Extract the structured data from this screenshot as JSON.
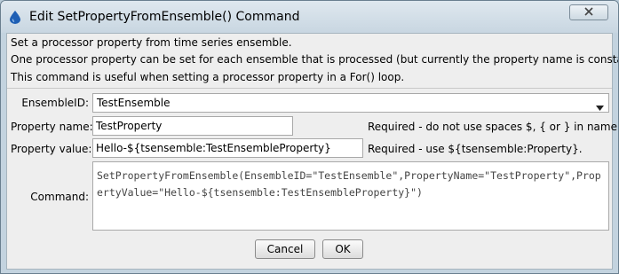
{
  "window": {
    "title": "Edit SetPropertyFromEnsemble() Command"
  },
  "info": {
    "line1": "Set a processor property from time series ensemble.",
    "line2": "One processor property can be set for each ensemble that is processed (but currently the property name is constant).",
    "line3": "This command is useful when setting a processor property in a For() loop."
  },
  "form": {
    "ensemble_label": "EnsembleID:",
    "ensemble_value": "TestEnsemble",
    "property_name_label": "Property name:",
    "property_name_value": "TestProperty",
    "property_name_note": "Required - do not use spaces $, { or } in name.",
    "property_value_label": "Property value:",
    "property_value_value": "Hello-${tsensemble:TestEnsembleProperty}",
    "property_value_note": "Required - use ${tsensemble:Property}.",
    "command_label": "Command:",
    "command_value": "SetPropertyFromEnsemble(EnsembleID=\"TestEnsemble\",PropertyName=\"TestProperty\",PropertyValue=\"Hello-${tsensemble:TestEnsembleProperty}\")"
  },
  "buttons": {
    "cancel": "Cancel",
    "ok": "OK"
  },
  "icons": {
    "title": "droplet-icon",
    "close": "close-icon",
    "dropdown": "chevron-down-icon"
  }
}
